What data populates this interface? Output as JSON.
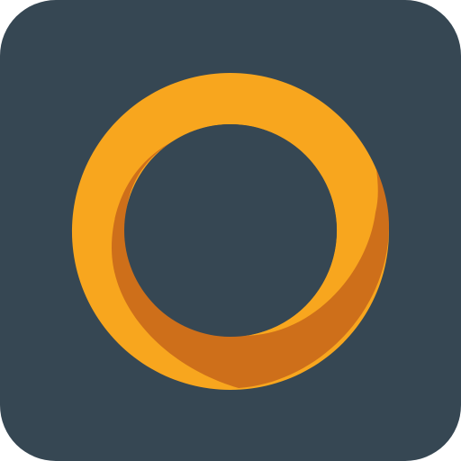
{
  "icon": {
    "name": "ring-app-icon",
    "background_color": "#364753",
    "ring_front_color": "#F8A61E",
    "ring_shadow_color": "#CE6F1A",
    "hole_color": "#364753"
  }
}
